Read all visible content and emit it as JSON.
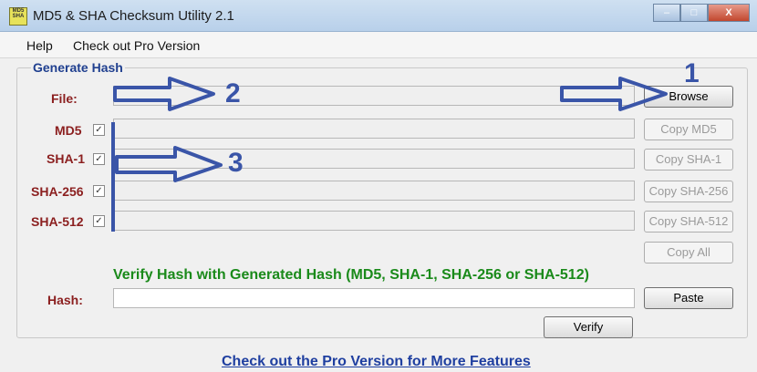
{
  "window": {
    "title": "MD5 & SHA Checksum Utility 2.1",
    "app_icon_text": "MD5 SHA",
    "controls": [
      "–",
      "□",
      "X"
    ]
  },
  "menu": [
    "Help",
    "Check out Pro Version"
  ],
  "generate_hash": {
    "title": "Generate Hash",
    "file_label": "File:",
    "browse_label": "Browse",
    "rows": [
      {
        "label": "MD5",
        "checked": true,
        "copy_label": "Copy MD5"
      },
      {
        "label": "SHA-1",
        "checked": true,
        "copy_label": "Copy SHA-1"
      },
      {
        "label": "SHA-256",
        "checked": true,
        "copy_label": "Copy SHA-256"
      },
      {
        "label": "SHA-512",
        "checked": true,
        "copy_label": "Copy SHA-512"
      }
    ],
    "copy_all_label": "Copy All"
  },
  "verify": {
    "heading": "Verify Hash with Generated Hash (MD5, SHA-1, SHA-256 or SHA-512)",
    "hash_label": "Hash:",
    "paste_label": "Paste",
    "verify_label": "Verify"
  },
  "footer_link": "Check out the Pro Version for More Features",
  "annotations": {
    "one": "1",
    "two": "2",
    "three": "3",
    "color": "#3a55a8"
  }
}
